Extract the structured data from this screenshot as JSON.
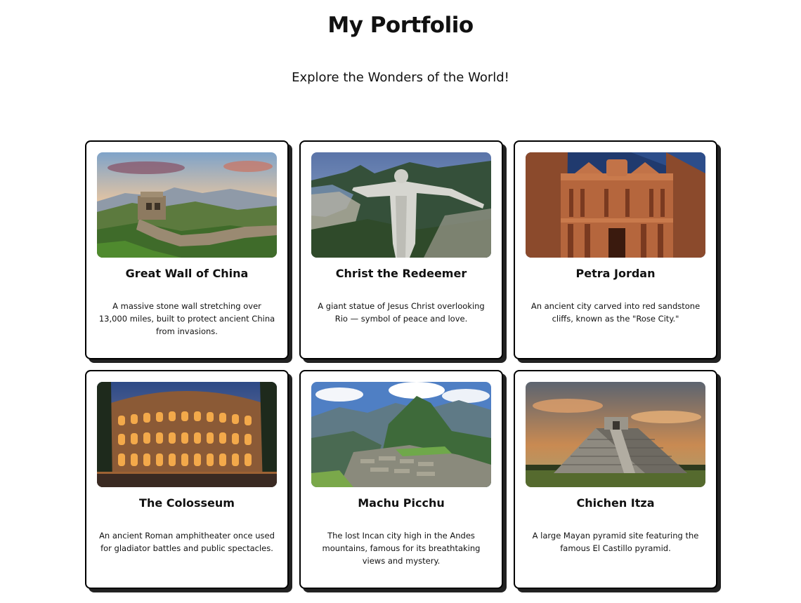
{
  "header": {
    "title": "My Portfolio",
    "subtitle": "Explore the Wonders of the World!"
  },
  "cards": [
    {
      "title": "Great Wall of China",
      "description": "A massive stone wall stretching over 13,000 miles, built to protect ancient China from invasions.",
      "image": "great-wall-photo"
    },
    {
      "title": "Christ the Redeemer",
      "description": "A giant statue of Jesus Christ overlooking Rio — symbol of peace and love.",
      "image": "christ-redeemer-photo"
    },
    {
      "title": "Petra Jordan",
      "description": "An ancient city carved into red sandstone cliffs, known as the \"Rose City.\"",
      "image": "petra-photo"
    },
    {
      "title": "The Colosseum",
      "description": "An ancient Roman amphitheater once used for gladiator battles and public spectacles.",
      "image": "colosseum-photo"
    },
    {
      "title": "Machu Picchu",
      "description": "The lost Incan city high in the Andes mountains, famous for its breathtaking views and mystery.",
      "image": "machu-picchu-photo"
    },
    {
      "title": "Chichen Itza",
      "description": "A large Mayan pyramid site featuring the famous El Castillo pyramid.",
      "image": "chichen-itza-photo"
    }
  ]
}
